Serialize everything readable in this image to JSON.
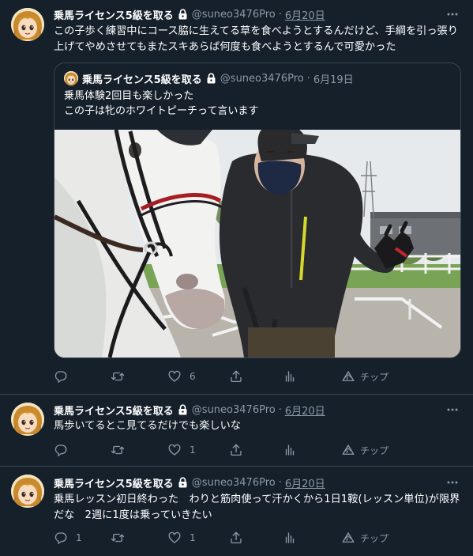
{
  "tweets": [
    {
      "name": "乗馬ライセンス5級を取る",
      "handle": "@suneo3476Pro",
      "separator": "·",
      "date": "6月20日",
      "text": "この子歩く練習中にコース脇に生えてる草を食べようとするんだけど、手綱を引っ張り上げてやめさせてもまたスキあらば何度も食べようとするんで可愛かった",
      "quote": {
        "name": "乗馬ライセンス5級を取る",
        "handle": "@suneo3476Pro",
        "separator": "·",
        "date": "6月19日",
        "text": "乗馬体験2回目も楽しかった\nこの子は牝のホワイトピーチって言います"
      },
      "reply_count": "",
      "retweet_count": "",
      "like_count": "6",
      "tip_label": "チップ"
    },
    {
      "name": "乗馬ライセンス5級を取る",
      "handle": "@suneo3476Pro",
      "separator": "·",
      "date": "6月20日",
      "text": "馬歩いてるとこ見てるだけでも楽しいな",
      "reply_count": "",
      "retweet_count": "",
      "like_count": "1",
      "tip_label": "チップ"
    },
    {
      "name": "乗馬ライセンス5級を取る",
      "handle": "@suneo3476Pro",
      "separator": "·",
      "date": "6月20日",
      "text": "乗馬レッスン初日終わった　わりと筋肉使って汗かくから1日1鞍(レッスン単位)が限界だな　2週に1度は乗っていきたい",
      "reply_count": "1",
      "retweet_count": "",
      "like_count": "1",
      "tip_label": "チップ"
    }
  ],
  "colors": {
    "background": "#15202b",
    "text": "#ffffff",
    "secondary": "#8b98a5",
    "border": "#38444d"
  }
}
